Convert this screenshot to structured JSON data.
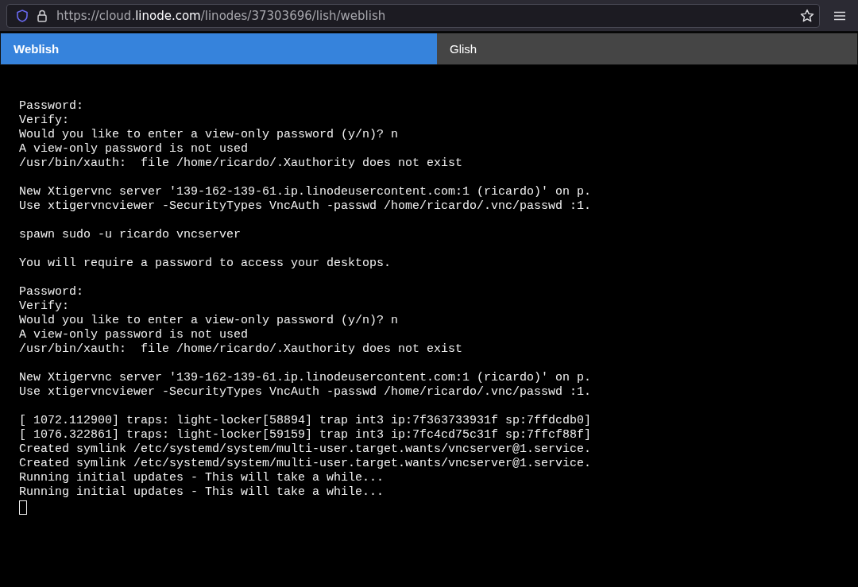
{
  "browser": {
    "url": {
      "prefix": "https://cloud.",
      "domain": "linode.com",
      "path": "/linodes/37303696/lish/weblish"
    }
  },
  "tabs": [
    {
      "label": "Weblish",
      "selected": true
    },
    {
      "label": "Glish",
      "selected": false
    }
  ],
  "terminal": {
    "blocks": [
      [
        "Password:",
        "Verify:",
        "Would you like to enter a view-only password (y/n)? n",
        "A view-only password is not used",
        "/usr/bin/xauth:  file /home/ricardo/.Xauthority does not exist"
      ],
      [
        "New Xtigervnc server '139-162-139-61.ip.linodeusercontent.com:1 (ricardo)' on p.",
        "Use xtigervncviewer -SecurityTypes VncAuth -passwd /home/ricardo/.vnc/passwd :1."
      ],
      [
        "spawn sudo -u ricardo vncserver"
      ],
      [
        "You will require a password to access your desktops."
      ],
      [
        "Password:",
        "Verify:",
        "Would you like to enter a view-only password (y/n)? n",
        "A view-only password is not used",
        "/usr/bin/xauth:  file /home/ricardo/.Xauthority does not exist"
      ],
      [
        "New Xtigervnc server '139-162-139-61.ip.linodeusercontent.com:1 (ricardo)' on p.",
        "Use xtigervncviewer -SecurityTypes VncAuth -passwd /home/ricardo/.vnc/passwd :1."
      ],
      [
        "[ 1072.112900] traps: light-locker[58894] trap int3 ip:7f363733931f sp:7ffdcdb0]",
        "[ 1076.322861] traps: light-locker[59159] trap int3 ip:7fc4cd75c31f sp:7ffcf88f]",
        "Created symlink /etc/systemd/system/multi-user.target.wants/vncserver@1.service.",
        "Created symlink /etc/systemd/system/multi-user.target.wants/vncserver@1.service.",
        "Running initial updates - This will take a while...",
        "Running initial updates - This will take a while..."
      ]
    ],
    "cursor": true
  }
}
